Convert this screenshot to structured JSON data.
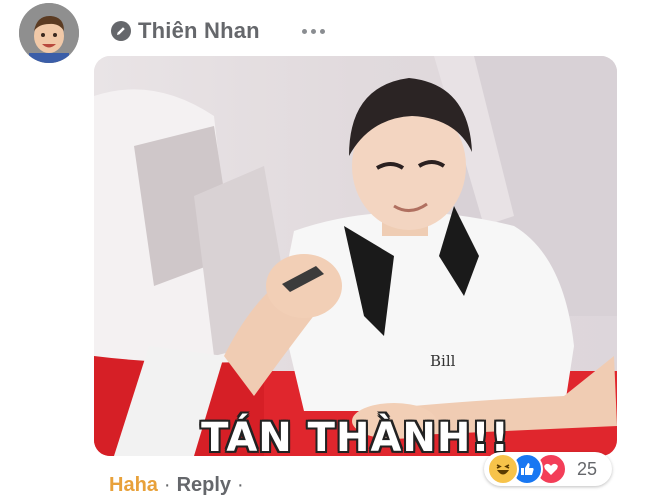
{
  "comment": {
    "author_name": "Thiên Nhan",
    "gif_caption": "TÁN THÀNH!!",
    "actions": {
      "reaction_label": "Haha",
      "separator": "·",
      "reply_label": "Reply",
      "trailing_separator": "·"
    },
    "reactions": {
      "types": [
        "haha",
        "like",
        "love"
      ],
      "count": "25"
    }
  },
  "colors": {
    "haha_text": "#e8a13a",
    "secondary_text": "#65676b",
    "like_blue": "#1877f2",
    "love_red": "#f33e58",
    "haha_yellow": "#f7c34a"
  }
}
